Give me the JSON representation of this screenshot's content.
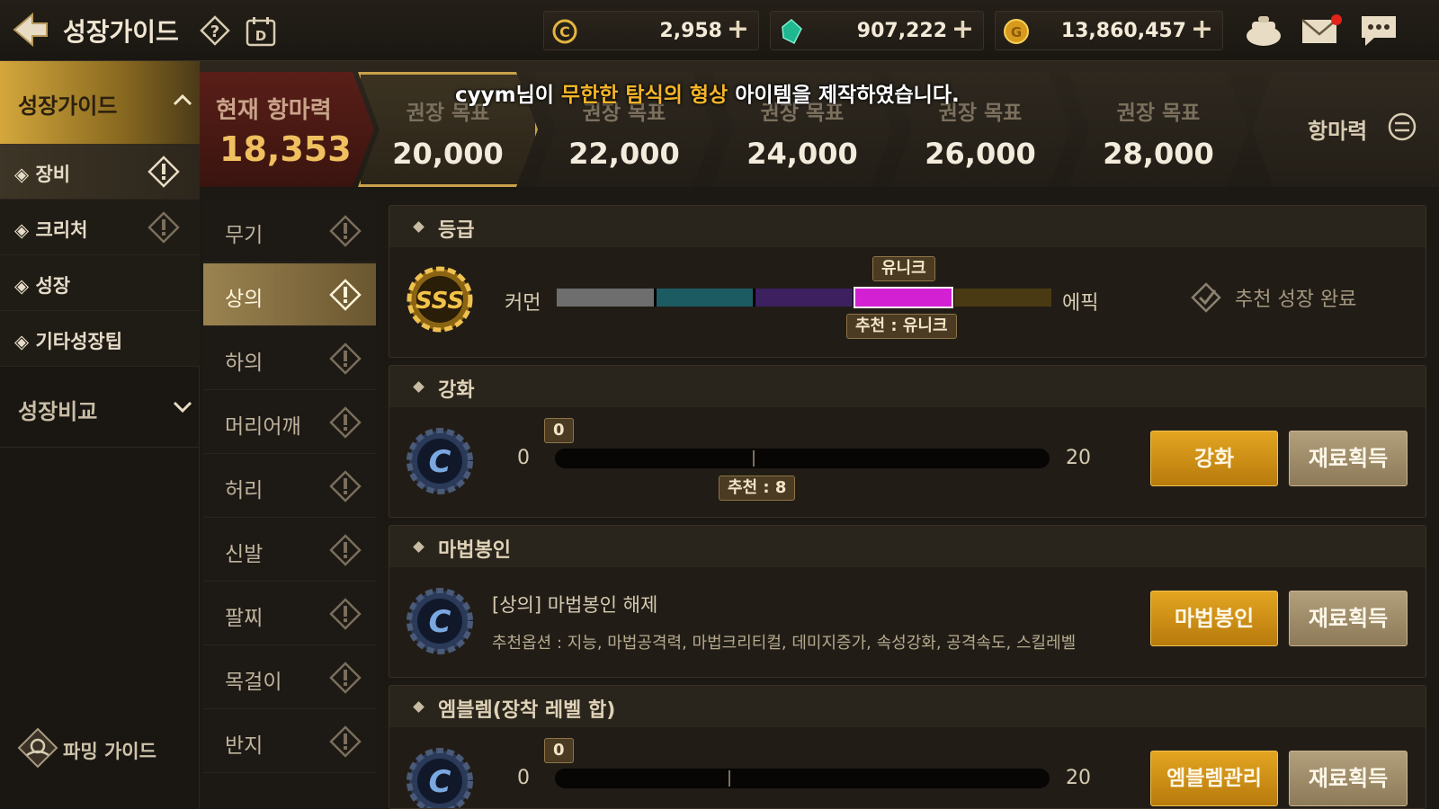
{
  "header": {
    "title": "성장가이드",
    "currencies": [
      {
        "name": "c-coin",
        "value": "2,958"
      },
      {
        "name": "gem",
        "value": "907,222"
      },
      {
        "name": "gold",
        "value": "13,860,457"
      }
    ],
    "plus": "+"
  },
  "leftnav": {
    "header": "성장가이드",
    "items": [
      {
        "label": "◈ 장비",
        "active": true
      },
      {
        "label": "◈ 크리처",
        "active": false
      },
      {
        "label": "◈ 성장",
        "active": false
      },
      {
        "label": "◈ 기타성장팁",
        "active": false
      }
    ],
    "compare": "성장비교",
    "farming": "파밍 가이드"
  },
  "targets": {
    "current_label": "현재 항마력",
    "current_value": "18,353",
    "goal_label": "권장 목표",
    "goals": [
      "20,000",
      "22,000",
      "24,000",
      "26,000",
      "28,000"
    ],
    "power_button": "항마력"
  },
  "notice": {
    "prefix": "cyym님이 ",
    "item": "무한한 탐식의 형상",
    "suffix": " 아이템을 제작하였습니다."
  },
  "subnav": {
    "items": [
      {
        "label": "무기",
        "active": false
      },
      {
        "label": "상의",
        "active": true
      },
      {
        "label": "하의",
        "active": false
      },
      {
        "label": "머리어깨",
        "active": false
      },
      {
        "label": "허리",
        "active": false
      },
      {
        "label": "신발",
        "active": false
      },
      {
        "label": "팔찌",
        "active": false
      },
      {
        "label": "목걸이",
        "active": false
      },
      {
        "label": "반지",
        "active": false
      }
    ]
  },
  "grade": {
    "title": "등급",
    "left": "커먼",
    "right": "에픽",
    "current": "유니크",
    "recommended": "추천 : 유니크",
    "status": "추천 성장 완료",
    "segments": [
      "#6e6e6e",
      "#1d5b63",
      "#3c2060",
      "#d320d3",
      "#4a3a14"
    ],
    "current_index": 3
  },
  "enhance": {
    "title": "강화",
    "min": "0",
    "max": "20",
    "current": "0",
    "recommended": "추천 : 8",
    "recommended_value": 8,
    "max_value": 20,
    "btn_primary": "강화",
    "btn_secondary": "재료획득"
  },
  "seal": {
    "title": "마법봉인",
    "line1": "[상의] 마법봉인 해제",
    "line2": "추천옵션 : 지능, 마법공격력, 마법크리티컬, 데미지증가, 속성강화, 공격속도, 스킬레벨",
    "btn_primary": "마법봉인",
    "btn_secondary": "재료획득"
  },
  "emblem": {
    "title": "엠블렘(장착 레벨 합)",
    "min": "0",
    "max": "20",
    "current": "0",
    "recommended_value": 7,
    "max_value": 20,
    "btn_primary": "엠블렘관리",
    "btn_secondary": "재료획득"
  }
}
